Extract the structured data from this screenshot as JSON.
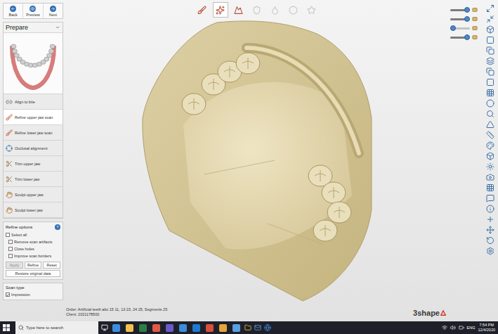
{
  "nav": [
    {
      "label": "Back"
    },
    {
      "label": "Preview"
    },
    {
      "label": "Next"
    }
  ],
  "panel": {
    "title": "Prepare",
    "steps": [
      {
        "label": "Align to bite",
        "selected": false
      },
      {
        "label": "Refine upper jaw scan",
        "selected": true
      },
      {
        "label": "Refine lower jaw scan",
        "selected": false
      },
      {
        "label": "Occlusal alignment",
        "selected": false
      },
      {
        "label": "Trim upper jaw",
        "selected": false
      },
      {
        "label": "Trim lower jaw",
        "selected": false
      },
      {
        "label": "Sculpt upper jaw",
        "selected": false
      },
      {
        "label": "Sculpt lower jaw",
        "selected": false
      }
    ]
  },
  "refine_options": {
    "title": "Refine options",
    "help": "?",
    "checkboxes": [
      {
        "label": "Select all",
        "checked": false
      },
      {
        "label": "Remove scan artifacts",
        "checked": false
      },
      {
        "label": "Close holes",
        "checked": false
      },
      {
        "label": "Improve scan borders",
        "checked": false
      }
    ],
    "buttons": [
      {
        "label": "Apply",
        "disabled": true
      },
      {
        "label": "Refine",
        "disabled": false
      },
      {
        "label": "Reset",
        "disabled": false
      }
    ],
    "restore": "Restore original data"
  },
  "scan_type": {
    "title": "Scan type",
    "options": [
      {
        "label": "Impression",
        "checked": true
      }
    ]
  },
  "top_toolbar": [
    {
      "selected": false,
      "disabled": false
    },
    {
      "selected": true,
      "disabled": false
    },
    {
      "selected": false,
      "disabled": false
    },
    {
      "selected": false,
      "disabled": true
    },
    {
      "selected": false,
      "disabled": true
    },
    {
      "selected": false,
      "disabled": true
    },
    {
      "selected": false,
      "disabled": true
    }
  ],
  "view_sliders": [
    {
      "level": 0.85
    },
    {
      "level": 0.85
    },
    {
      "level": 0.15
    },
    {
      "level": 0.85
    }
  ],
  "order_info": [
    "Order: Artificial teeth abc 15 11, 13 23, 24 25, Segments 25",
    "Client: 2021178500"
  ],
  "logo": {
    "text": "3shape"
  },
  "taskbar": {
    "search": {
      "placeholder": "Type here to search"
    },
    "language": "ENG",
    "time": "7:54 PM",
    "date": "12/4/2020"
  }
}
